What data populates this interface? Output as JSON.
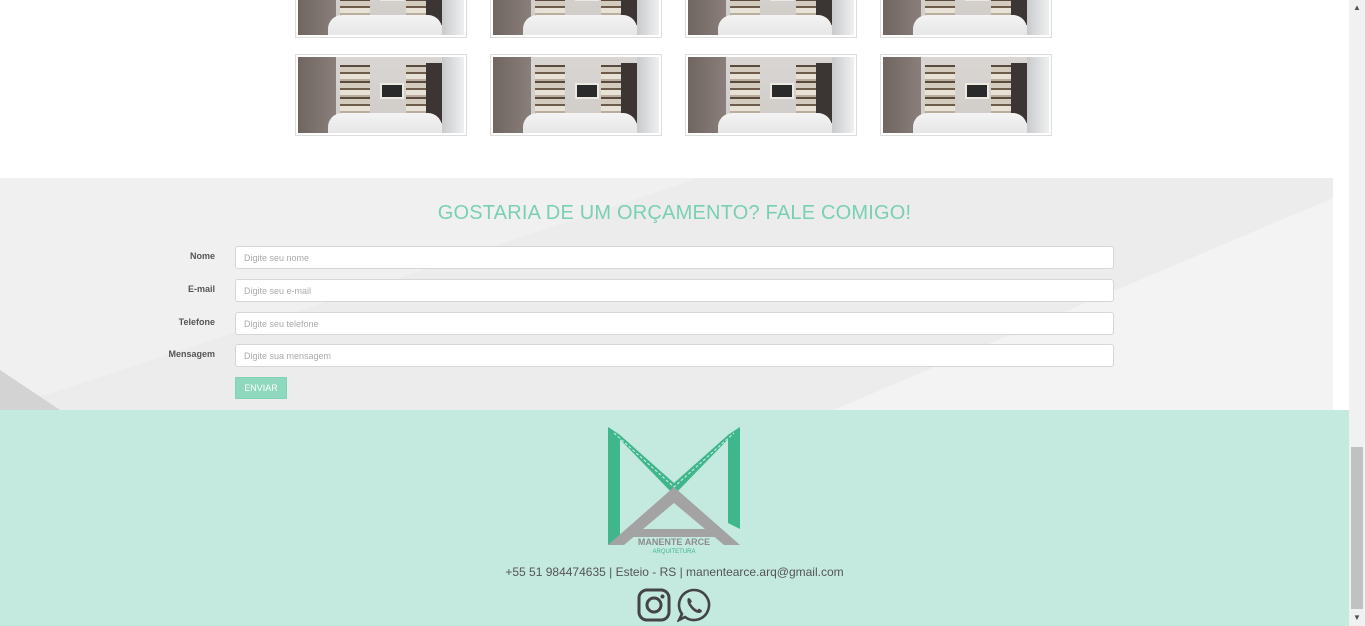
{
  "gallery": {
    "count": 8
  },
  "contact": {
    "title": "GOSTARIA DE UM ORÇAMENTO? FALE COMIGO!",
    "fields": [
      {
        "label": "Nome",
        "placeholder": "Digite seu nome",
        "value": ""
      },
      {
        "label": "E-mail",
        "placeholder": "Digite seu e-mail",
        "value": ""
      },
      {
        "label": "Telefone",
        "placeholder": "Digite seu telefone",
        "value": ""
      },
      {
        "label": "Mensagem",
        "placeholder": "Digite sua mensagem",
        "value": ""
      }
    ],
    "submit_label": "ENVIAR"
  },
  "footer": {
    "logo_text": "MANENTE ARCE",
    "logo_subtext": "ARQUITETURA",
    "contact_line": "+55 51 984474635 | Esteio - RS | manentearce.arq@gmail.com",
    "icons": [
      "instagram-icon",
      "whatsapp-icon"
    ]
  },
  "colors": {
    "accent": "#79d0b4",
    "footer_bg": "#c4e9de",
    "logo_green": "#3fb68c",
    "logo_gray": "#a3a3a3"
  },
  "scrollbar": {
    "up_glyph": "▲",
    "down_glyph": "▼"
  }
}
